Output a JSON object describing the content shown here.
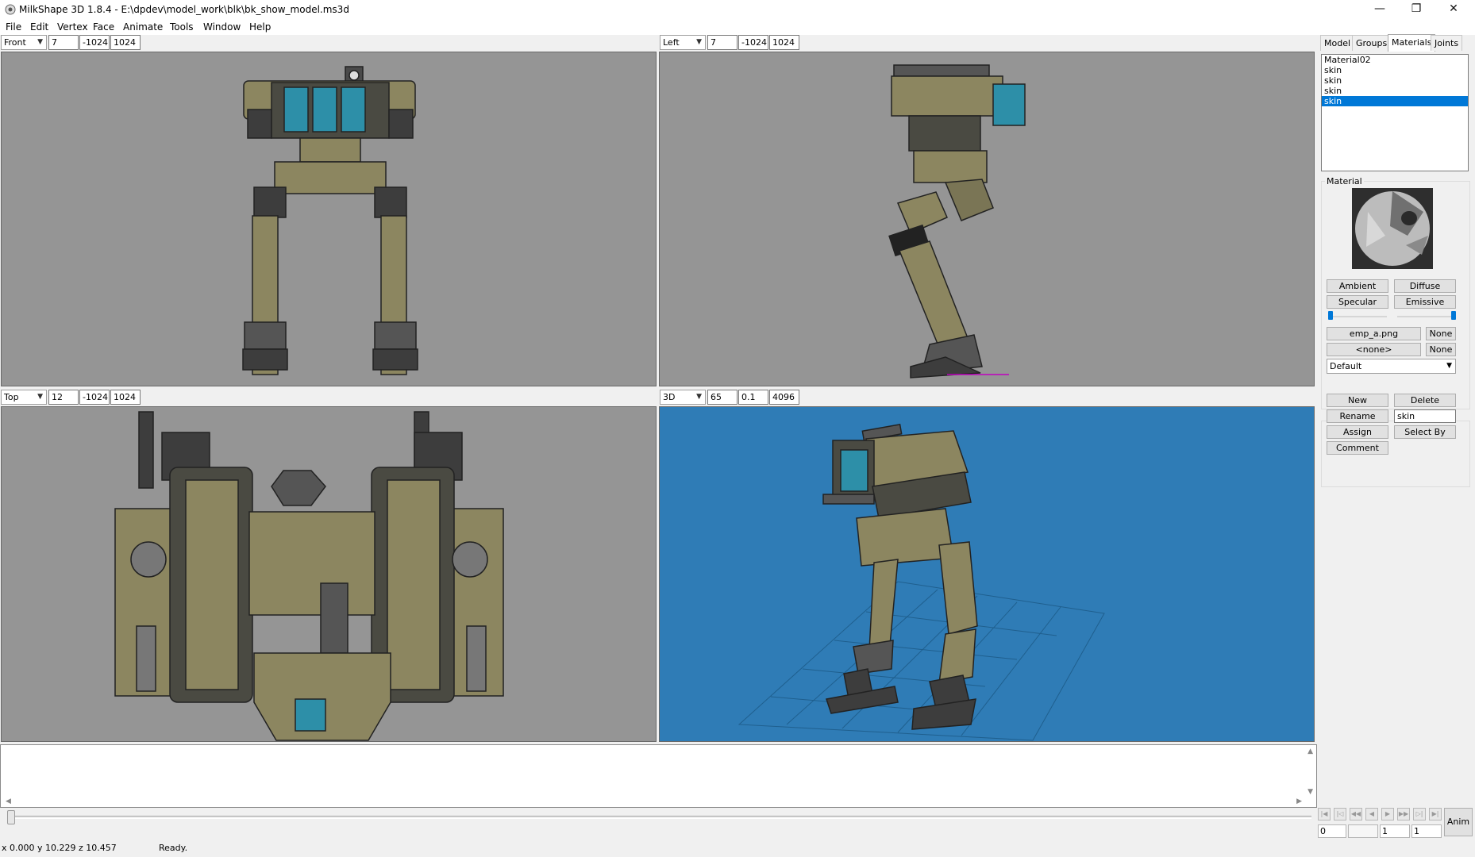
{
  "window": {
    "title": "MilkShape 3D 1.8.4 - E:\\dpdev\\model_work\\blk\\bk_show_model.ms3d",
    "minimize": "—",
    "maximize": "❐",
    "close": "✕"
  },
  "menu": [
    "File",
    "Edit",
    "Vertex",
    "Face",
    "Animate",
    "Tools",
    "Window",
    "Help"
  ],
  "viewports": [
    {
      "view": "Front",
      "fields": [
        "7",
        "-1024",
        "1024"
      ]
    },
    {
      "view": "Left",
      "fields": [
        "7",
        "-1024",
        "1024"
      ]
    },
    {
      "view": "Top",
      "fields": [
        "12",
        "-1024",
        "1024"
      ]
    },
    {
      "view": "3D",
      "fields": [
        "65",
        "0.1",
        "4096"
      ]
    }
  ],
  "colors": {
    "viewport_bg": "#959595",
    "viewport_3d_bg": "#2f7cb6",
    "selection": "#0078d7"
  },
  "panel": {
    "tabs": [
      "Model",
      "Groups",
      "Materials",
      "Joints"
    ],
    "active_tab": "Materials",
    "materials": [
      "Material02",
      "skin",
      "skin",
      "skin",
      "skin"
    ],
    "selected_index": 4,
    "material_label": "Material",
    "buttons": {
      "ambient": "Ambient",
      "diffuse": "Diffuse",
      "specular": "Specular",
      "emissive": "Emissive",
      "texture1": "emp_a.png",
      "texture1_none": "None",
      "texture2": "<none>",
      "texture2_none": "None",
      "new": "New",
      "delete": "Delete",
      "rename": "Rename",
      "assign": "Assign",
      "select_by": "Select By",
      "comment": "Comment"
    },
    "blend_mode": "Default",
    "name_field": "skin",
    "anim_button": "Anim",
    "frame_fields": [
      "0",
      "",
      "1",
      "1"
    ]
  },
  "status": {
    "coords": "x 0.000 y 10.229 z 10.457",
    "message": "Ready."
  }
}
